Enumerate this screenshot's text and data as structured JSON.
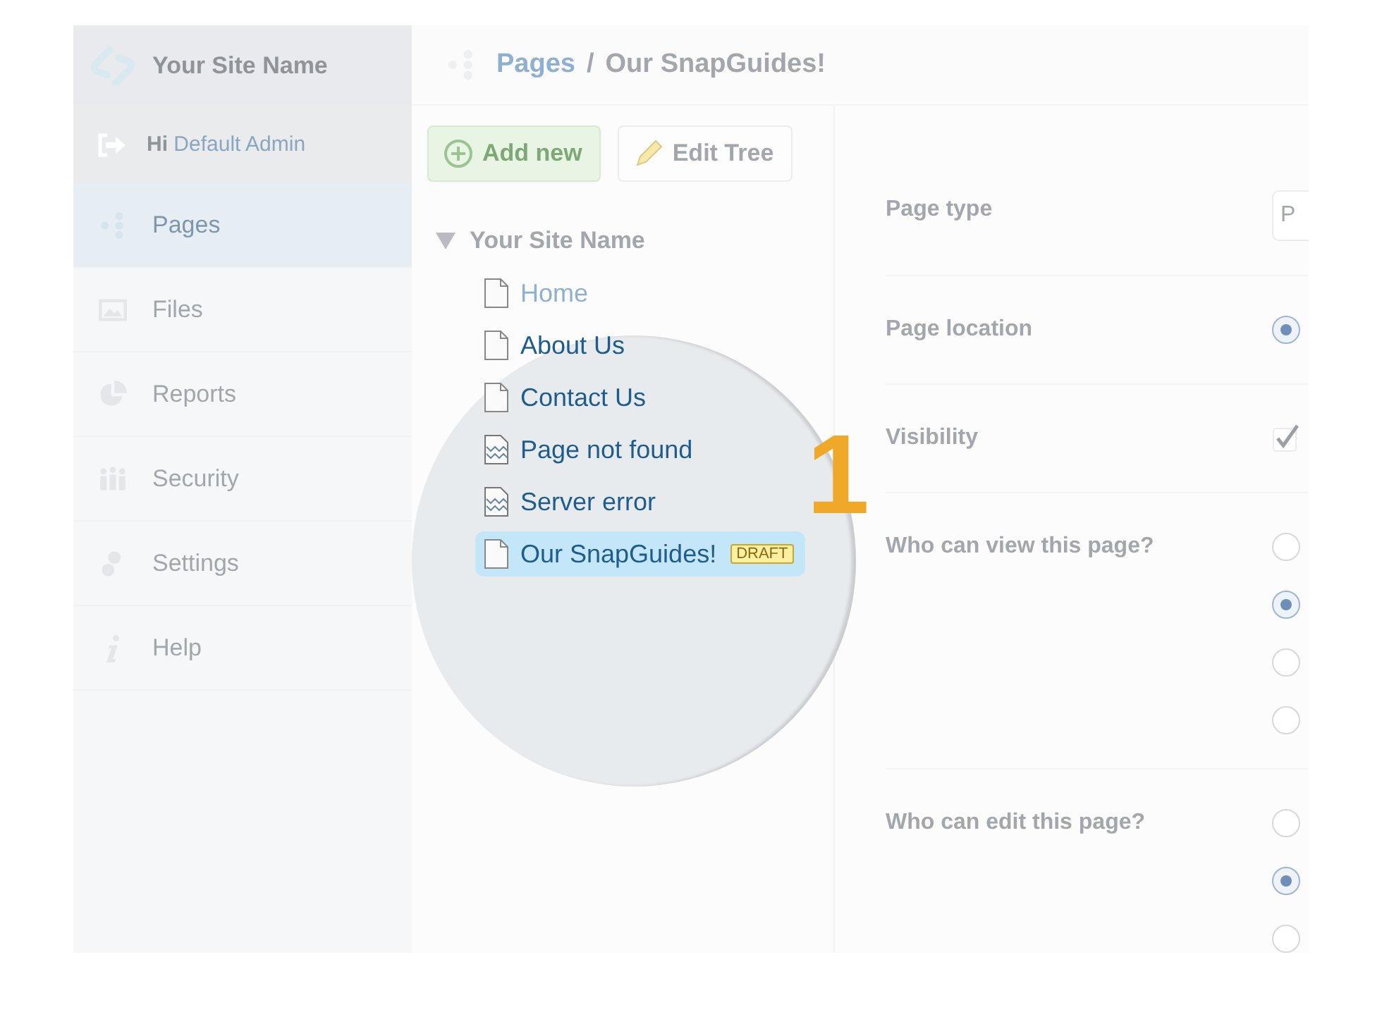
{
  "sidebar": {
    "site_name": "Your Site Name",
    "greeting": "Hi",
    "user": "Default Admin",
    "items": [
      {
        "label": "Pages",
        "selected": true
      },
      {
        "label": "Files",
        "selected": false
      },
      {
        "label": "Reports",
        "selected": false
      },
      {
        "label": "Security",
        "selected": false
      },
      {
        "label": "Settings",
        "selected": false
      },
      {
        "label": "Help",
        "selected": false
      }
    ]
  },
  "breadcrumb": {
    "section": "Pages",
    "separator": "/",
    "page": "Our SnapGuides!"
  },
  "toolbar": {
    "buttons": [
      {
        "label": "Add new",
        "kind": "add"
      },
      {
        "label": "Edit Tree",
        "kind": "edit"
      }
    ]
  },
  "tree": {
    "label": "Your Site Name",
    "expanded": true,
    "children": [
      {
        "label": "Home",
        "kind": "page",
        "magnified": false,
        "selected": false
      },
      {
        "label": "About Us",
        "kind": "page",
        "magnified": true,
        "selected": false
      },
      {
        "label": "Contact Us",
        "kind": "page",
        "magnified": true,
        "selected": false
      },
      {
        "label": "Page not found",
        "kind": "error",
        "magnified": true,
        "selected": false
      },
      {
        "label": "Server error",
        "kind": "error",
        "magnified": true,
        "selected": false
      },
      {
        "label": "Our SnapGuides!",
        "kind": "page",
        "magnified": true,
        "selected": true,
        "badge": "DRAFT"
      }
    ]
  },
  "callout": "1",
  "form": {
    "rows": [
      {
        "label": "Page type",
        "kind": "select",
        "value": "P"
      },
      {
        "label": "Page location",
        "kind": "radio",
        "options": [
          {
            "selected": true
          }
        ]
      },
      {
        "label": "Visibility",
        "kind": "checkbox",
        "checked": true
      },
      {
        "label": "Who can view this page?",
        "kind": "radio",
        "options": [
          {
            "selected": false
          },
          {
            "selected": true
          },
          {
            "selected": false
          },
          {
            "selected": false
          }
        ]
      },
      {
        "label": "Who can edit this page?",
        "kind": "radio",
        "options": [
          {
            "selected": false
          },
          {
            "selected": true
          },
          {
            "selected": false
          }
        ]
      }
    ]
  }
}
